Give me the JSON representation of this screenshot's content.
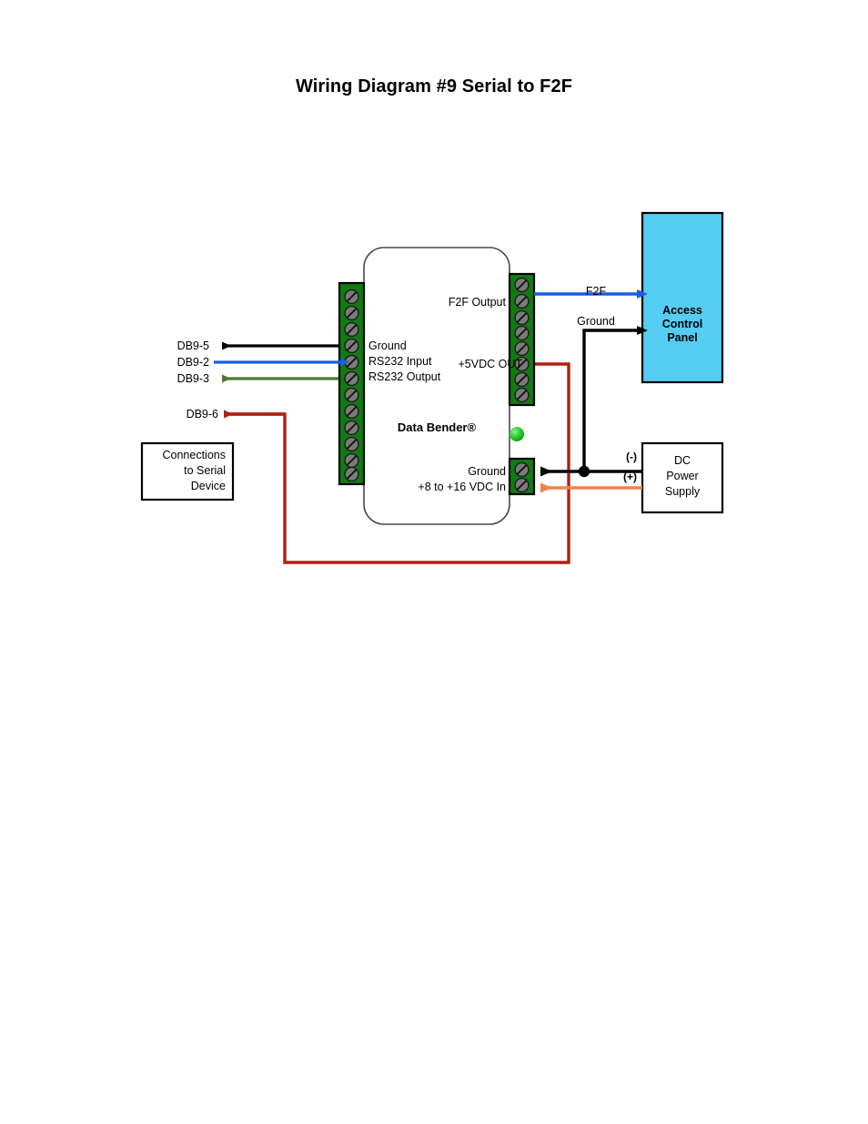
{
  "page": {
    "title": "Wiring Diagram #9 Serial to F2F"
  },
  "device": {
    "brand": "Data Bender®",
    "left_terminal_labels": {
      "ground": "Ground",
      "rs232_input": "RS232 Input",
      "rs232_output": "RS232 Output"
    },
    "right_terminal_labels": {
      "f2f_output": "F2F Output",
      "vdc_out": "+5VDC OUT"
    },
    "power_terminal_labels": {
      "ground": "Ground",
      "vdc_in": "+8 to +16 VDC In"
    },
    "led_name": "power-led",
    "led_color": "#22cc22",
    "terminal_block_color": "#127a12",
    "screw_color": "#777777"
  },
  "serial_side": {
    "pins": [
      {
        "name": "DB9-5",
        "color": "#000000",
        "direction": "left"
      },
      {
        "name": "DB9-2",
        "color": "#1a5fe0",
        "direction": "right"
      },
      {
        "name": "DB9-3",
        "color": "#4c7a32",
        "direction": "left"
      },
      {
        "name": "DB9-6",
        "color": "#b01f10",
        "direction": "left"
      }
    ],
    "box": {
      "line1": "Connections",
      "line2": "to Serial",
      "line3": "Device"
    }
  },
  "access_panel": {
    "line1": "Access",
    "line2": "Control",
    "line3": "Panel",
    "fill": "#55ccf2",
    "wires": [
      {
        "label": "F2F",
        "color": "#1a5fe0"
      },
      {
        "label": "Ground",
        "color": "#000000"
      }
    ]
  },
  "power_supply": {
    "line1": "DC",
    "line2": "Power",
    "line3": "Supply",
    "fill": "#ffffff",
    "terminals": [
      {
        "label": "(-)",
        "color": "#000000"
      },
      {
        "label": "(+)",
        "color": "#f2814a"
      }
    ]
  }
}
